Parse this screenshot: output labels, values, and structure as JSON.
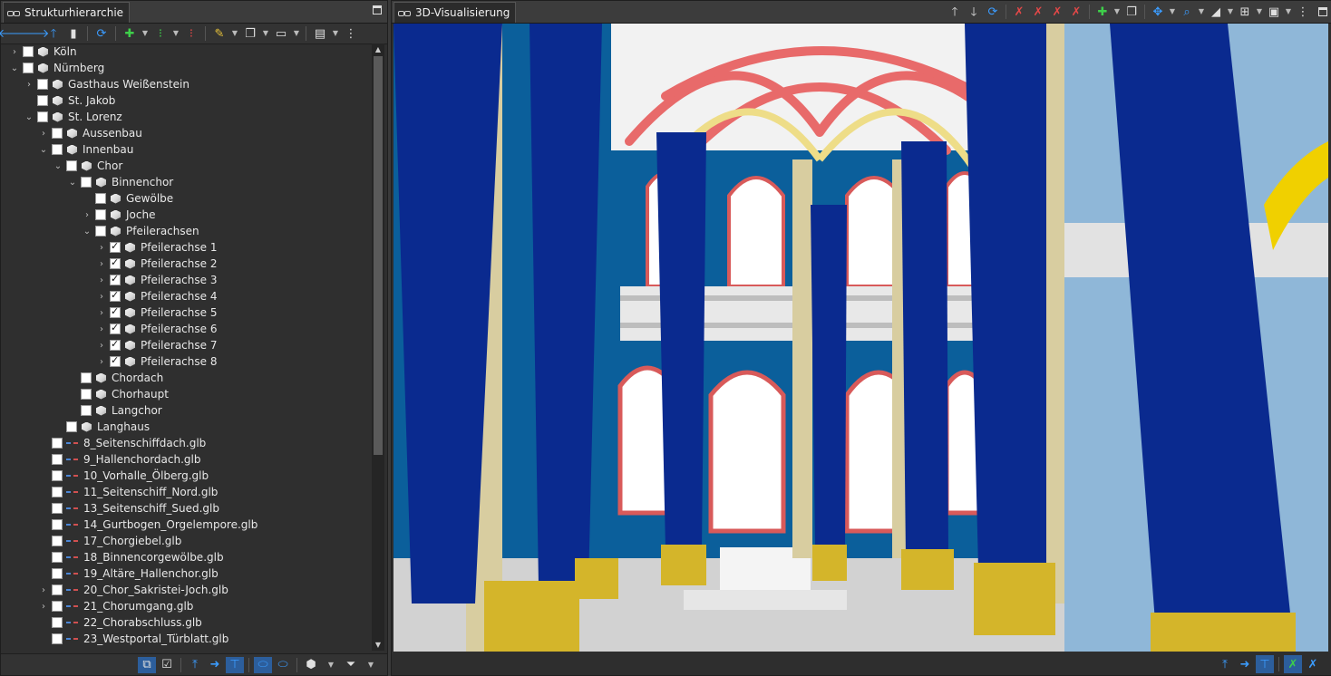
{
  "left_panel": {
    "tab_title": "Strukturhierarchie",
    "toolbar": [
      "arrow-left-icon",
      "arrow-right-icon",
      "arrow-up-icon",
      "mouse-icon",
      "refresh-icon",
      "add-icon",
      "more-icon",
      "remove-icon",
      "pencil-icon",
      "copy-icon",
      "view-icon",
      "panel-icon",
      "menu-icon"
    ],
    "tree": [
      {
        "label": "Köln",
        "indent": 0,
        "chevron": "right",
        "checked": false,
        "icon": "cube"
      },
      {
        "label": "Nürnberg",
        "indent": 0,
        "chevron": "down",
        "checked": false,
        "icon": "cube"
      },
      {
        "label": "Gasthaus Weißenstein",
        "indent": 1,
        "chevron": "right",
        "checked": false,
        "icon": "cube"
      },
      {
        "label": "St. Jakob",
        "indent": 1,
        "chevron": "",
        "checked": false,
        "icon": "cube"
      },
      {
        "label": "St. Lorenz",
        "indent": 1,
        "chevron": "down",
        "checked": false,
        "icon": "cube"
      },
      {
        "label": "Aussenbau",
        "indent": 2,
        "chevron": "right",
        "checked": false,
        "icon": "cube"
      },
      {
        "label": "Innenbau",
        "indent": 2,
        "chevron": "down",
        "checked": false,
        "icon": "cube"
      },
      {
        "label": "Chor",
        "indent": 3,
        "chevron": "down",
        "checked": false,
        "icon": "cube"
      },
      {
        "label": "Binnenchor",
        "indent": 4,
        "chevron": "down",
        "checked": false,
        "icon": "cube"
      },
      {
        "label": "Gewölbe",
        "indent": 5,
        "chevron": "",
        "checked": false,
        "icon": "cube"
      },
      {
        "label": "Joche",
        "indent": 5,
        "chevron": "right",
        "checked": false,
        "icon": "cube"
      },
      {
        "label": "Pfeilerachsen",
        "indent": 5,
        "chevron": "down",
        "checked": false,
        "icon": "cube"
      },
      {
        "label": "Pfeilerachse 1",
        "indent": 6,
        "chevron": "right",
        "checked": true,
        "icon": "cube"
      },
      {
        "label": "Pfeilerachse 2",
        "indent": 6,
        "chevron": "right",
        "checked": true,
        "icon": "cube"
      },
      {
        "label": "Pfeilerachse 3",
        "indent": 6,
        "chevron": "right",
        "checked": true,
        "icon": "cube"
      },
      {
        "label": "Pfeilerachse 4",
        "indent": 6,
        "chevron": "right",
        "checked": true,
        "icon": "cube"
      },
      {
        "label": "Pfeilerachse 5",
        "indent": 6,
        "chevron": "right",
        "checked": true,
        "icon": "cube"
      },
      {
        "label": "Pfeilerachse 6",
        "indent": 6,
        "chevron": "right",
        "checked": true,
        "icon": "cube"
      },
      {
        "label": "Pfeilerachse 7",
        "indent": 6,
        "chevron": "right",
        "checked": true,
        "icon": "cube"
      },
      {
        "label": "Pfeilerachse 8",
        "indent": 6,
        "chevron": "right",
        "checked": true,
        "icon": "cube"
      },
      {
        "label": "Chordach",
        "indent": 4,
        "chevron": "",
        "checked": false,
        "icon": "cube"
      },
      {
        "label": "Chorhaupt",
        "indent": 4,
        "chevron": "",
        "checked": false,
        "icon": "cube"
      },
      {
        "label": "Langchor",
        "indent": 4,
        "chevron": "",
        "checked": false,
        "icon": "cube"
      },
      {
        "label": "Langhaus",
        "indent": 3,
        "chevron": "",
        "checked": false,
        "icon": "cube"
      },
      {
        "label": "8_Seitenschiffdach.glb",
        "indent": 2,
        "chevron": "",
        "checked": false,
        "icon": "glb"
      },
      {
        "label": "9_Hallenchordach.glb",
        "indent": 2,
        "chevron": "",
        "checked": false,
        "icon": "glb"
      },
      {
        "label": "10_Vorhalle_Ölberg.glb",
        "indent": 2,
        "chevron": "",
        "checked": false,
        "icon": "glb"
      },
      {
        "label": "11_Seitenschiff_Nord.glb",
        "indent": 2,
        "chevron": "",
        "checked": false,
        "icon": "glb"
      },
      {
        "label": "13_Seitenschiff_Sued.glb",
        "indent": 2,
        "chevron": "",
        "checked": false,
        "icon": "glb"
      },
      {
        "label": "14_Gurtbogen_Orgelempore.glb",
        "indent": 2,
        "chevron": "",
        "checked": false,
        "icon": "glb"
      },
      {
        "label": "17_Chorgiebel.glb",
        "indent": 2,
        "chevron": "",
        "checked": false,
        "icon": "glb"
      },
      {
        "label": "18_Binnencorgewölbe.glb",
        "indent": 2,
        "chevron": "",
        "checked": false,
        "icon": "glb"
      },
      {
        "label": "19_Altäre_Hallenchor.glb",
        "indent": 2,
        "chevron": "",
        "checked": false,
        "icon": "glb"
      },
      {
        "label": "20_Chor_Sakristei-Joch.glb",
        "indent": 2,
        "chevron": "right",
        "checked": false,
        "icon": "glb"
      },
      {
        "label": "21_Chorumgang.glb",
        "indent": 2,
        "chevron": "right",
        "checked": false,
        "icon": "glb"
      },
      {
        "label": "22_Chorabschluss.glb",
        "indent": 2,
        "chevron": "",
        "checked": false,
        "icon": "glb"
      },
      {
        "label": "23_Westportal_Türblatt.glb",
        "indent": 2,
        "chevron": "",
        "checked": false,
        "icon": "glb"
      }
    ]
  },
  "right_panel": {
    "tab_title": "3D-Visualisierung"
  }
}
